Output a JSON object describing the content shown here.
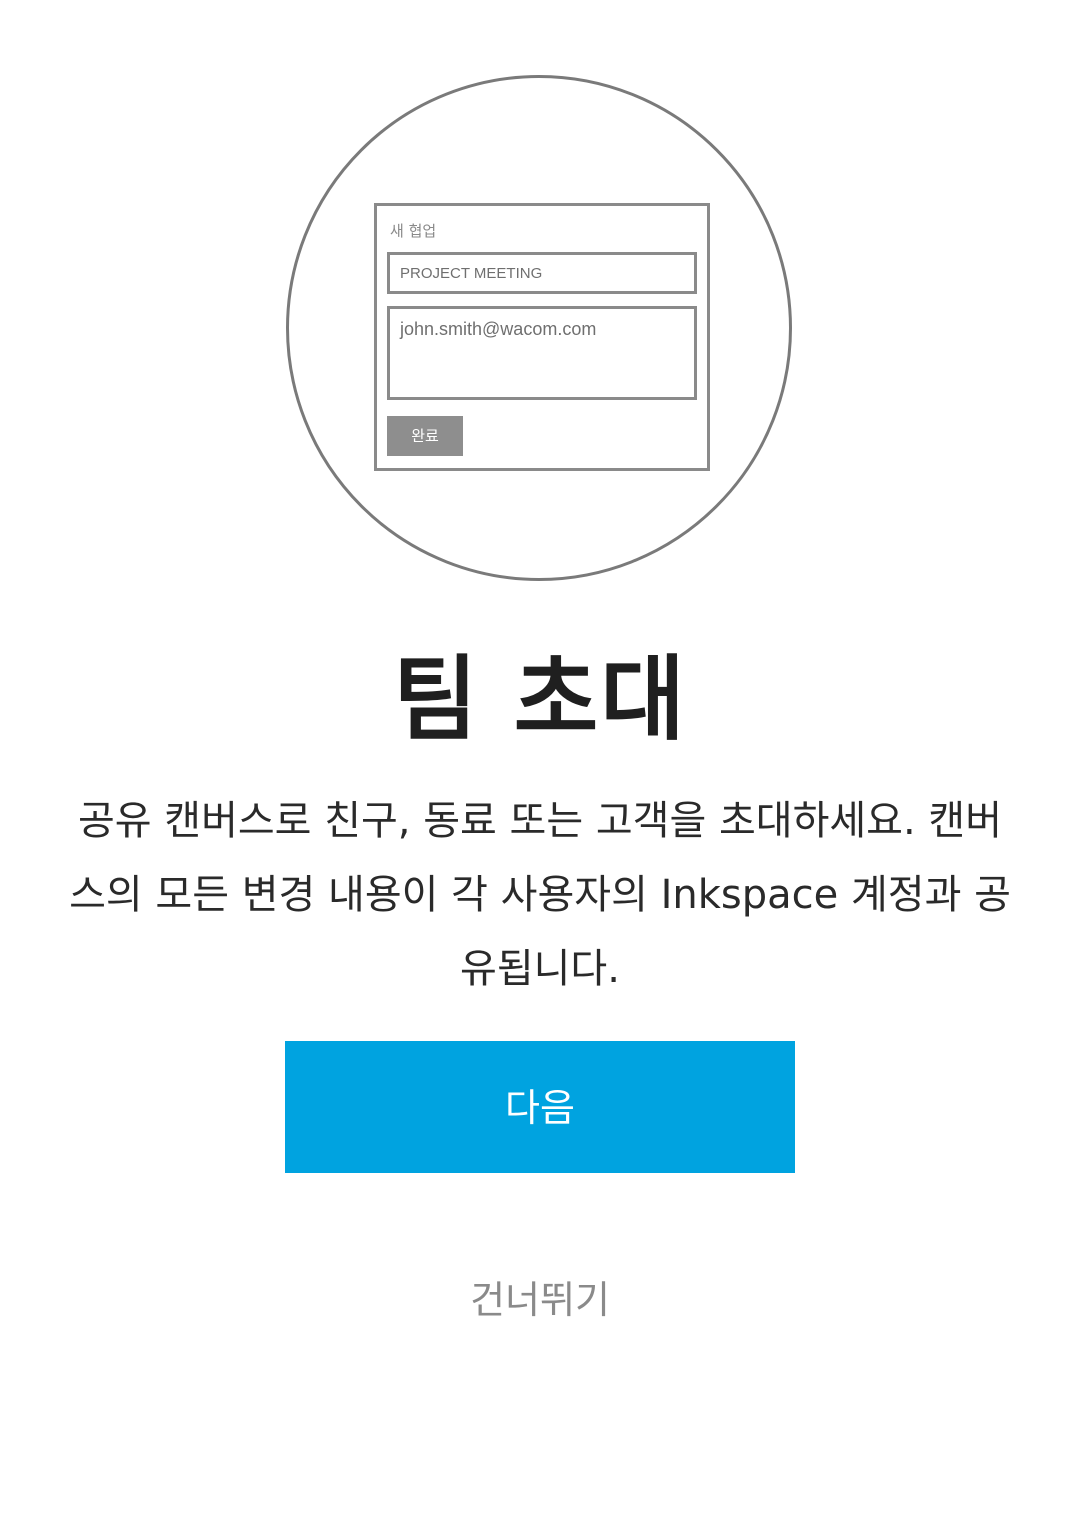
{
  "illustration": {
    "form_title": "새 협업",
    "project_name": "PROJECT MEETING",
    "email": "john.smith@wacom.com",
    "done_button": "완료"
  },
  "title": "팀 초대",
  "description": "공유 캔버스로 친구, 동료 또는 고객을 초대하세요. 캔버스의 모든 변경 내용이 각 사용자의 Inkspace 계정과 공유됩니다.",
  "next_button": "다음",
  "skip_link": "건너뛰기",
  "colors": {
    "accent": "#00a3e0",
    "illustration_stroke": "#7a7a7a",
    "skip_text": "#8a8a8a"
  }
}
